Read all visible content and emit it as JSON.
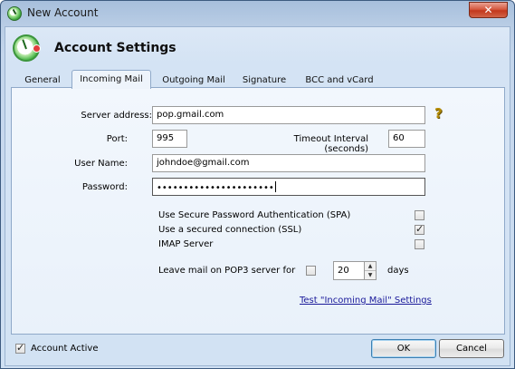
{
  "window": {
    "title": "New Account",
    "close_glyph": "✕"
  },
  "header": {
    "title": "Account Settings"
  },
  "tabs": [
    {
      "label": "General",
      "active": false
    },
    {
      "label": "Incoming Mail",
      "active": true
    },
    {
      "label": "Outgoing Mail",
      "active": false
    },
    {
      "label": "Signature",
      "active": false
    },
    {
      "label": "BCC and vCard",
      "active": false
    }
  ],
  "incoming": {
    "server_label": "Server address:",
    "server_value": "pop.gmail.com",
    "help_glyph": "?",
    "port_label": "Port:",
    "port_value": "995",
    "timeout_label": "Timeout Interval (seconds)",
    "timeout_value": "60",
    "username_label": "User Name:",
    "username_value": "johndoe@gmail.com",
    "password_label": "Password:",
    "password_value": "••••••••••••••••••••••",
    "options": [
      {
        "label": "Use Secure Password Authentication (SPA)",
        "checked": false
      },
      {
        "label": "Use a secured connection (SSL)",
        "checked": true
      },
      {
        "label": "IMAP Server",
        "checked": false
      }
    ],
    "leave_mail_label": "Leave mail on POP3 server for",
    "leave_mail_checked": false,
    "days_value": "20",
    "days_label": "days",
    "test_link": "Test \"Incoming Mail\" Settings"
  },
  "footer": {
    "account_active_label": "Account Active",
    "account_active_checked": true,
    "ok_label": "OK",
    "cancel_label": "Cancel"
  },
  "icons": {
    "app": "account-clock-icon",
    "help": "help-question-icon",
    "spin_up": "▲",
    "spin_down": "▼"
  }
}
